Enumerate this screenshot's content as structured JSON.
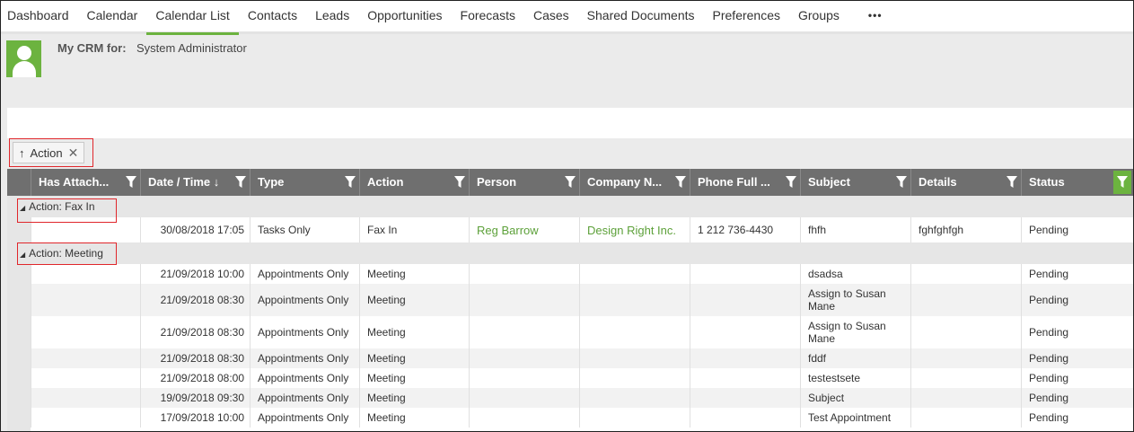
{
  "nav": {
    "items": [
      "Dashboard",
      "Calendar",
      "Calendar List",
      "Contacts",
      "Leads",
      "Opportunities",
      "Forecasts",
      "Cases",
      "Shared Documents",
      "Preferences",
      "Groups"
    ],
    "more": "•••"
  },
  "header": {
    "crm_label": "My CRM for:",
    "user_name": "System Administrator"
  },
  "group_chip": {
    "arrow": "↑",
    "label": "Action",
    "close": "✕"
  },
  "columns": [
    "Has Attach...",
    "Date / Time ↓",
    "Type",
    "Action",
    "Person",
    "Company N...",
    "Phone Full ...",
    "Subject",
    "Details",
    "Status"
  ],
  "groups": [
    {
      "label": "Action: Fax In",
      "rows": [
        {
          "date": "30/08/2018 17:05",
          "type": "Tasks Only",
          "action": "Fax In",
          "person": "Reg Barrow",
          "company": "Design Right Inc.",
          "phone": "1 212 736-4430",
          "subject": "fhfh",
          "details": "fghfghfgh",
          "status": "Pending"
        }
      ]
    },
    {
      "label": "Action: Meeting",
      "rows": [
        {
          "date": "21/09/2018 10:00",
          "type": "Appointments Only",
          "action": "Meeting",
          "person": "",
          "company": "",
          "phone": "",
          "subject": "dsadsa",
          "details": "",
          "status": "Pending"
        },
        {
          "date": "21/09/2018 08:30",
          "type": "Appointments Only",
          "action": "Meeting",
          "person": "",
          "company": "",
          "phone": "",
          "subject": "Assign to Susan Mane",
          "details": "",
          "status": "Pending"
        },
        {
          "date": "21/09/2018 08:30",
          "type": "Appointments Only",
          "action": "Meeting",
          "person": "",
          "company": "",
          "phone": "",
          "subject": "Assign to Susan Mane",
          "details": "",
          "status": "Pending"
        },
        {
          "date": "21/09/2018 08:30",
          "type": "Appointments Only",
          "action": "Meeting",
          "person": "",
          "company": "",
          "phone": "",
          "subject": "fddf",
          "details": "",
          "status": "Pending"
        },
        {
          "date": "21/09/2018 08:00",
          "type": "Appointments Only",
          "action": "Meeting",
          "person": "",
          "company": "",
          "phone": "",
          "subject": "testestsete",
          "details": "",
          "status": "Pending"
        },
        {
          "date": "19/09/2018 09:30",
          "type": "Appointments Only",
          "action": "Meeting",
          "person": "",
          "company": "",
          "phone": "",
          "subject": "Subject",
          "details": "",
          "status": "Pending"
        },
        {
          "date": "17/09/2018 10:00",
          "type": "Appointments Only",
          "action": "Meeting",
          "person": "",
          "company": "",
          "phone": "",
          "subject": "Test Appointment",
          "details": "",
          "status": "Pending"
        }
      ]
    }
  ],
  "colors": {
    "accent": "#6cb33f",
    "header_bg": "#6f6f6f",
    "highlight": "#e0262b"
  },
  "icons": {
    "filter": "filter-icon",
    "avatar": "user-avatar-icon"
  }
}
